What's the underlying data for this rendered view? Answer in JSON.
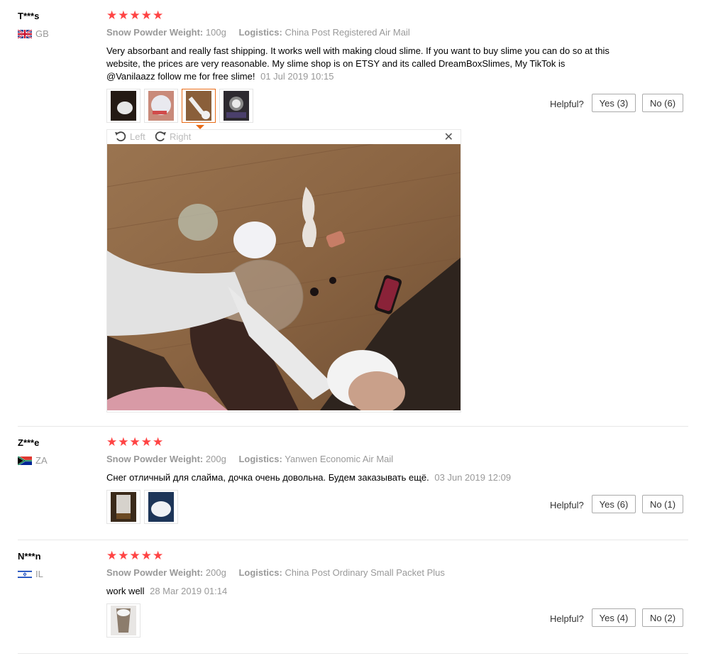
{
  "helpful_label": "Helpful?",
  "viewer": {
    "left_label": "Left",
    "right_label": "Right",
    "close_icon": "close-icon"
  },
  "reviews": [
    {
      "user": "T***s",
      "country": "GB",
      "stars": "★★★★★",
      "weight_key": "Snow Powder Weight:",
      "weight": "100g",
      "logistics_key": "Logistics:",
      "logistics": "China Post Registered Air Mail",
      "text": "Very absorbant and really fast shipping. It works well with making cloud slime. If you want to buy slime you can do so at this website, the prices are very reasonable. My slime shop is on ETSY and its called DreamBoxSlimes, My TikTok is @Vanilaazz follow me for free slime!",
      "date": "01 Jul 2019 10:15",
      "yes": "Yes (3)",
      "no": "No (6)"
    },
    {
      "user": "Z***e",
      "country": "ZA",
      "stars": "★★★★★",
      "weight_key": "Snow Powder Weight:",
      "weight": "200g",
      "logistics_key": "Logistics:",
      "logistics": "Yanwen Economic Air Mail",
      "text": "Снег отличный для слайма, дочка очень довольна. Будем заказывать ещё.",
      "date": "03 Jun 2019 12:09",
      "yes": "Yes (6)",
      "no": "No (1)"
    },
    {
      "user": "N***n",
      "country": "IL",
      "stars": "★★★★★",
      "weight_key": "Snow Powder Weight:",
      "weight": "200g",
      "logistics_key": "Logistics:",
      "logistics": "China Post Ordinary Small Packet Plus",
      "text": "work well",
      "date": "28 Mar 2019 01:14",
      "yes": "Yes (4)",
      "no": "No (2)"
    }
  ],
  "colors": {
    "star": "#ff4747",
    "active_thumb": "#e96b16",
    "muted": "#999999"
  }
}
